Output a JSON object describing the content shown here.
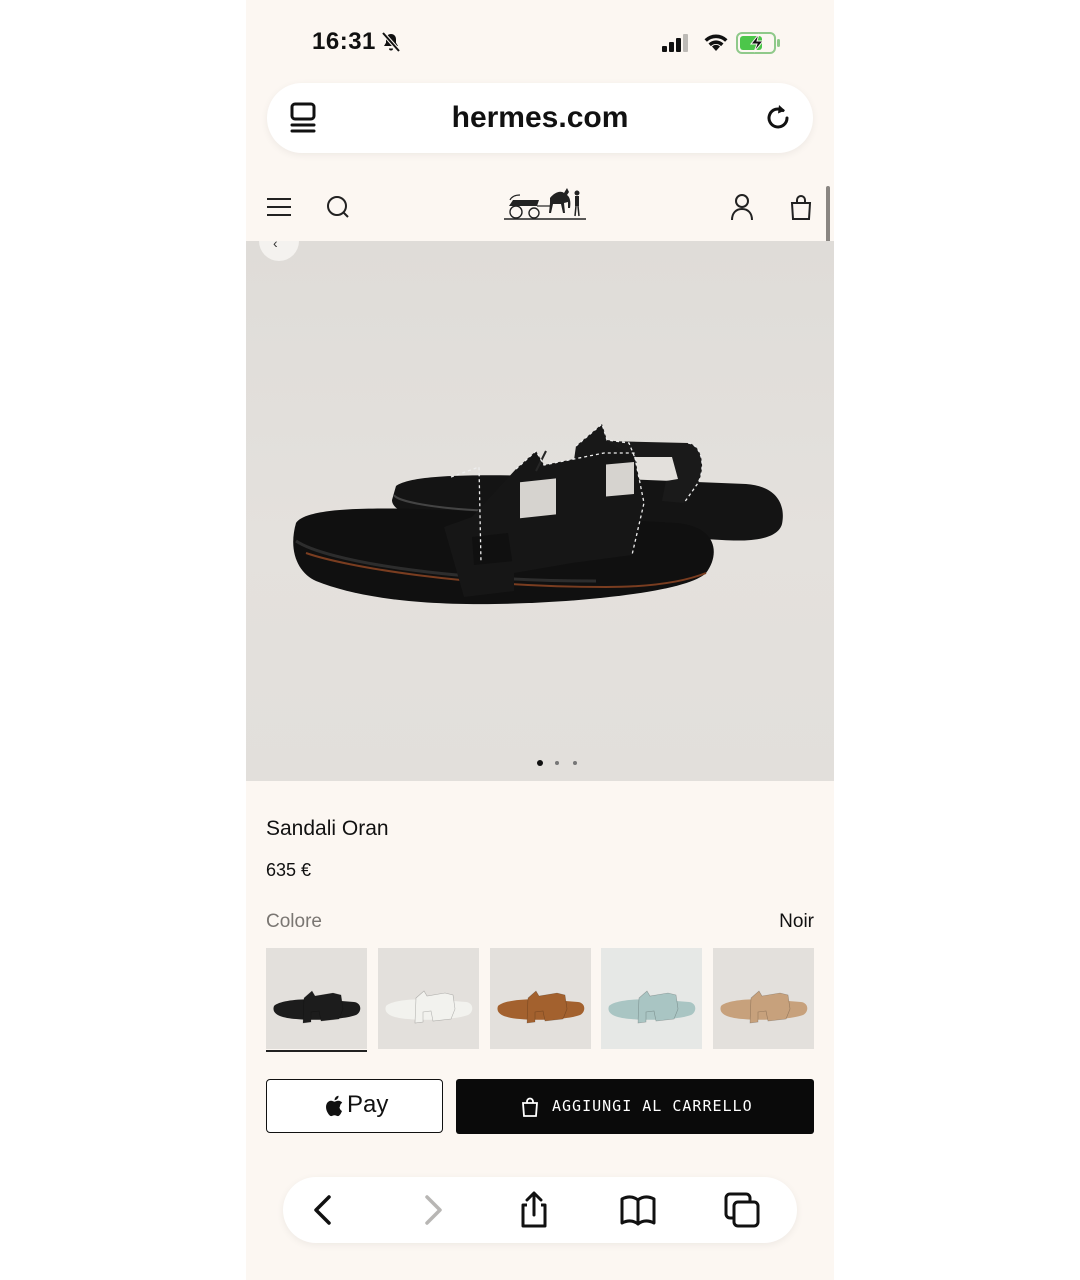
{
  "status_bar": {
    "time": "16:31"
  },
  "browser": {
    "url": "hermes.com"
  },
  "product": {
    "title": "Sandali Oran",
    "price": "635 €",
    "color_label": "Colore",
    "color_value": "Noir",
    "image_pages": 3,
    "current_image": 1,
    "swatches": [
      {
        "color": "#1c1c1c",
        "selected": true
      },
      {
        "color": "#f2f2ee",
        "selected": false
      },
      {
        "color": "#a3612e",
        "selected": false
      },
      {
        "color": "#a9c5c3",
        "selected": false
      },
      {
        "color": "#c7a17c",
        "selected": false
      }
    ]
  },
  "buttons": {
    "apple_pay": "Pay",
    "add_to_cart": "AGGIUNGI AL CARRELLO"
  },
  "icons": {
    "header": [
      "menu-icon",
      "search-icon",
      "hermes-logo",
      "user-icon",
      "shopping-bag-icon"
    ],
    "toolbar": [
      "back-icon",
      "forward-icon",
      "share-icon",
      "bookmarks-icon",
      "tabs-icon"
    ]
  }
}
